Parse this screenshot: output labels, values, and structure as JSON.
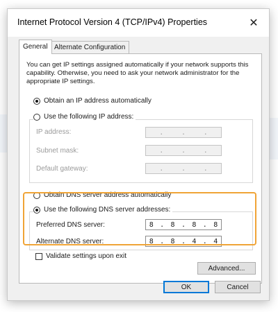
{
  "window": {
    "title": "Internet Protocol Version 4 (TCP/IPv4) Properties"
  },
  "tabs": [
    {
      "label": "General",
      "active": true
    },
    {
      "label": "Alternate Configuration",
      "active": false
    }
  ],
  "intro_text": "You can get IP settings assigned automatically if your network supports this capability. Otherwise, you need to ask your network administrator for the appropriate IP settings.",
  "ip_settings": {
    "auto_label": "Obtain an IP address automatically",
    "auto_selected": true,
    "manual_label": "Use the following IP address:",
    "manual_selected": false,
    "fields": [
      {
        "label": "IP address:",
        "octets": [
          "",
          "",
          "",
          ""
        ]
      },
      {
        "label": "Subnet mask:",
        "octets": [
          "",
          "",
          "",
          ""
        ]
      },
      {
        "label": "Default gateway:",
        "octets": [
          "",
          "",
          "",
          ""
        ]
      }
    ]
  },
  "dns_settings": {
    "auto_label": "Obtain DNS server address automatically",
    "auto_selected": false,
    "manual_label": "Use the following DNS server addresses:",
    "manual_selected": true,
    "preferred_label": "Preferred DNS server:",
    "preferred_octets": [
      "8",
      "8",
      "8",
      "8"
    ],
    "alternate_label": "Alternate DNS server:",
    "alternate_octets": [
      "8",
      "8",
      "4",
      "4"
    ]
  },
  "validate": {
    "label": "Validate settings upon exit",
    "checked": false
  },
  "buttons": {
    "advanced": "Advanced...",
    "ok": "OK",
    "cancel": "Cancel"
  },
  "colors": {
    "highlight": "#f0a436",
    "ok_border": "#0078d7"
  },
  "icons": {
    "close": "close-icon"
  }
}
